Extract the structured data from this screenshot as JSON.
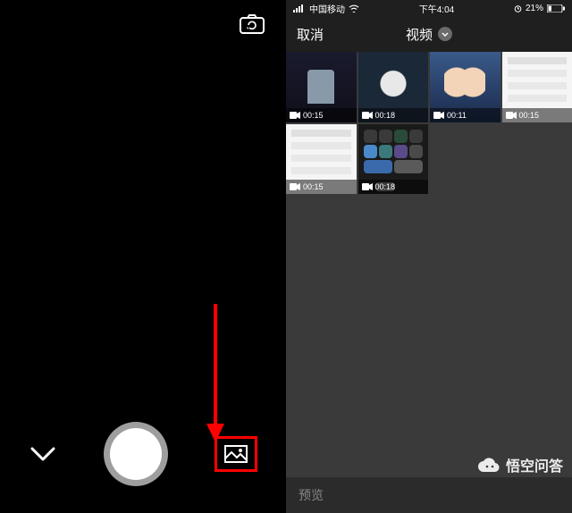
{
  "status": {
    "carrier": "中国移动",
    "time": "下午4:04",
    "battery": "21%"
  },
  "left": {
    "cam_switch_name": "switch-camera-icon",
    "chevron_name": "chevron-down-icon",
    "shutter_name": "shutter-button",
    "gallery_name": "gallery-button"
  },
  "picker": {
    "cancel": "取消",
    "title": "视频",
    "preview": "预览"
  },
  "thumbs": [
    {
      "duration": "00:15"
    },
    {
      "duration": "00:18"
    },
    {
      "duration": "00:11"
    },
    {
      "duration": "00:15"
    },
    {
      "duration": "00:15"
    },
    {
      "duration": "00:18"
    }
  ],
  "watermark": "悟空问答"
}
